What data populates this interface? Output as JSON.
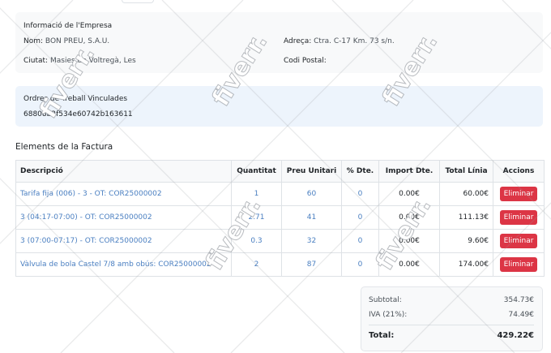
{
  "company": {
    "title": "Informació de l'Empresa",
    "name_label": "Nom:",
    "name_value": "BON PREU, S.A.U.",
    "address_label": "Adreça:",
    "address_value": "Ctra. C-17 Km. 73 s/n.",
    "city_label": "Ciutat:",
    "city_value": "Masies de Voltregà, Les",
    "postal_label": "Codi Postal:",
    "postal_value": ""
  },
  "orders": {
    "title": "Ordres de Treball Vinculades",
    "id": "68808b2f534e60742b163611"
  },
  "invoice_items": {
    "title": "Elements de la Factura",
    "columns": [
      "Descripció",
      "Quantitat",
      "Preu Unitari",
      "% Dte.",
      "Import Dte.",
      "Total Línia",
      "Accions"
    ],
    "delete_label": "Eliminar",
    "rows": [
      {
        "description": "Tarifa fija (006) - 3 - OT: COR25000002",
        "quantity": "1",
        "unit_price": "60",
        "discount_pct": "0",
        "discount_amount": "0.00€",
        "line_total": "60.00€"
      },
      {
        "description": "3 (04:17-07:00) - OT: COR25000002",
        "quantity": "2.71",
        "unit_price": "41",
        "discount_pct": "0",
        "discount_amount": "0.00€",
        "line_total": "111.13€"
      },
      {
        "description": "3 (07:00-07:17) - OT: COR25000002",
        "quantity": "0.3",
        "unit_price": "32",
        "discount_pct": "0",
        "discount_amount": "0.00€",
        "line_total": "9.60€"
      },
      {
        "description": "Vàlvula de bola Castel 7/8 amb obús: COR25000002",
        "quantity": "2",
        "unit_price": "87",
        "discount_pct": "0",
        "discount_amount": "0.00€",
        "line_total": "174.00€"
      }
    ]
  },
  "totals": {
    "subtotal_label": "Subtotal:",
    "subtotal_value": "354.73€",
    "vat_label": "IVA (21%):",
    "vat_value": "74.49€",
    "total_label": "Total:",
    "total_value": "429.22€"
  },
  "watermark": {
    "text": "fiverr."
  },
  "colors": {
    "accent_link": "#4a7fc1",
    "danger": "#dc3545",
    "orders_bg": "#edf4fc",
    "card_bg": "#f8f9fa"
  }
}
